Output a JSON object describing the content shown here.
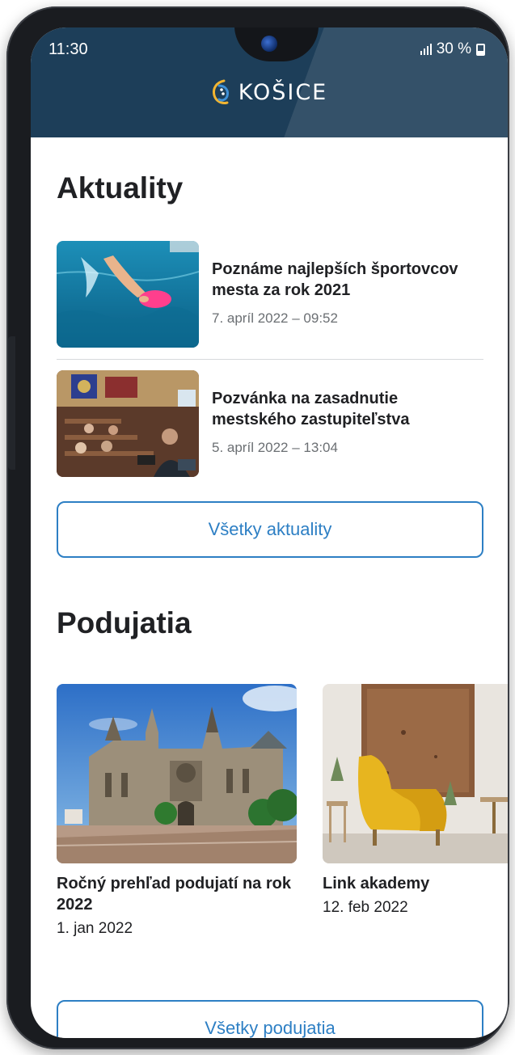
{
  "status_bar": {
    "time": "11:30",
    "battery": "30 %"
  },
  "header": {
    "logo_text": "KOŠICE"
  },
  "news": {
    "title": "Aktuality",
    "items": [
      {
        "title": "Poznáme najlepších športovcov mesta za rok 2021",
        "date": "7. apríl 2022 – 09:52"
      },
      {
        "title": "Pozvánka na zasadnutie mestského zastupiteľstva",
        "date": "5. apríl 2022 – 13:04"
      }
    ],
    "all_button": "Všetky aktuality"
  },
  "events": {
    "title": "Podujatia",
    "items": [
      {
        "title": "Ročný prehľad podujatí na rok 2022",
        "date": "1. jan 2022"
      },
      {
        "title": "Link akademy",
        "date": "12. feb 2022"
      }
    ],
    "all_button": "Všetky podujatia"
  },
  "colors": {
    "header_bg": "#1d3e59",
    "accent": "#2d7fc4",
    "text": "#202124",
    "muted": "#6b6f73"
  }
}
